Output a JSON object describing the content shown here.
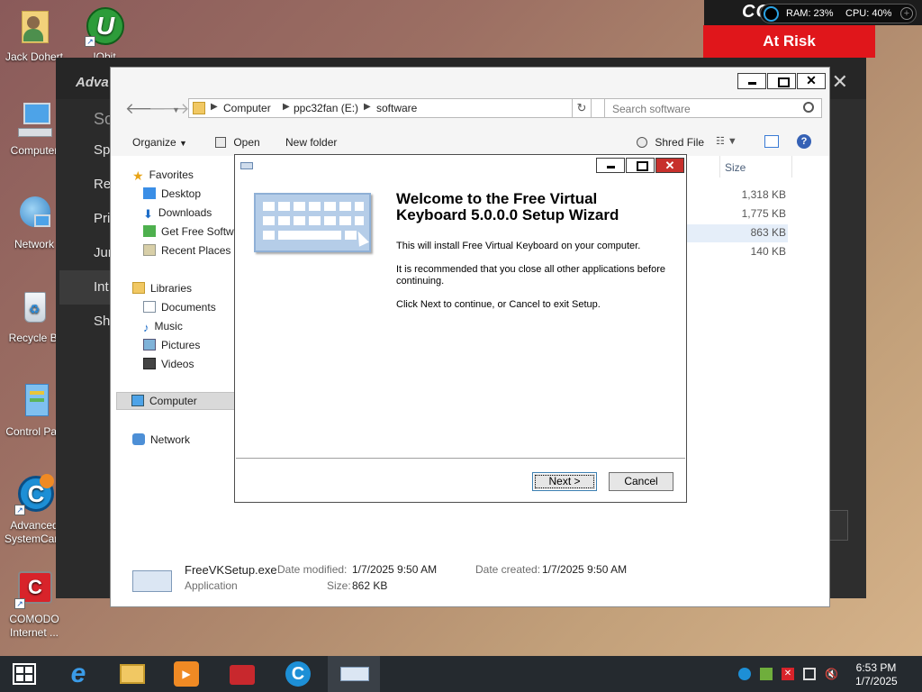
{
  "desktop_icons": [
    {
      "label": "Jack Dohert",
      "icon": "user-folder-icon"
    },
    {
      "label": "IObit",
      "icon": "iobit-uninstaller-icon"
    },
    {
      "label": "Computer",
      "icon": "computer-icon"
    },
    {
      "label": "Network",
      "icon": "network-icon"
    },
    {
      "label": "Recycle Bi",
      "icon": "recycle-bin-icon"
    },
    {
      "label": "Control Pan",
      "icon": "control-panel-icon"
    },
    {
      "label": "Advanced",
      "label2": "SystemCare",
      "icon": "advanced-systemcare-icon"
    },
    {
      "label": "COMODO",
      "label2": "Internet ...",
      "icon": "comodo-icon"
    }
  ],
  "comodo_widget": {
    "brand": "CO",
    "ram": "RAM: 23%",
    "cpu": "CPU: 40%",
    "status": "At Risk",
    "status_color": "#e0161b"
  },
  "asc_window": {
    "title": "Adva",
    "heading": "So",
    "menu": [
      "Spy",
      "Re",
      "Priv",
      "Jun",
      "Int",
      "She"
    ],
    "selected_index": 4
  },
  "explorer": {
    "breadcrumb": [
      "Computer",
      "ppc32fan (E:)",
      "software"
    ],
    "search_placeholder": "Search software",
    "toolbar": {
      "organize": "Organize",
      "open": "Open",
      "new_folder": "New folder",
      "shred_file": "Shred File"
    },
    "nav": {
      "favorites_header": "Favorites",
      "favorites": [
        "Desktop",
        "Downloads",
        "Get Free Softwa",
        "Recent Places"
      ],
      "libraries_header": "Libraries",
      "libraries": [
        "Documents",
        "Music",
        "Pictures",
        "Videos"
      ],
      "computer": "Computer",
      "network": "Network"
    },
    "columns": {
      "size": "Size"
    },
    "sizes": [
      "1,318 KB",
      "1,775 KB",
      "863 KB",
      "140 KB"
    ],
    "highlighted_row": 2,
    "details": {
      "name": "FreeVKSetup.exe",
      "type": "Application",
      "modified_label": "Date modified:",
      "modified_value": "1/7/2025 9:50 AM",
      "created_label": "Date created:",
      "created_value": "1/7/2025 9:50 AM",
      "size_label": "Size:",
      "size_value": "862 KB"
    }
  },
  "wizard": {
    "title": "Welcome to the Free Virtual Keyboard 5.0.0.0 Setup Wizard",
    "p1": "This will install Free Virtual Keyboard on your computer.",
    "p2": "It is recommended that you close all other applications before continuing.",
    "p3": "Click Next to continue, or Cancel to exit Setup.",
    "next": "Next >",
    "cancel": "Cancel"
  },
  "taskbar": {
    "apps": [
      "start-button",
      "internet-explorer-icon",
      "file-explorer-icon",
      "media-player-icon",
      "toolbox-icon",
      "advanced-systemcare-icon",
      "virtual-keyboard-icon"
    ],
    "active_app": "virtual-keyboard-icon",
    "time": "6:53 PM",
    "date": "1/7/2025"
  }
}
